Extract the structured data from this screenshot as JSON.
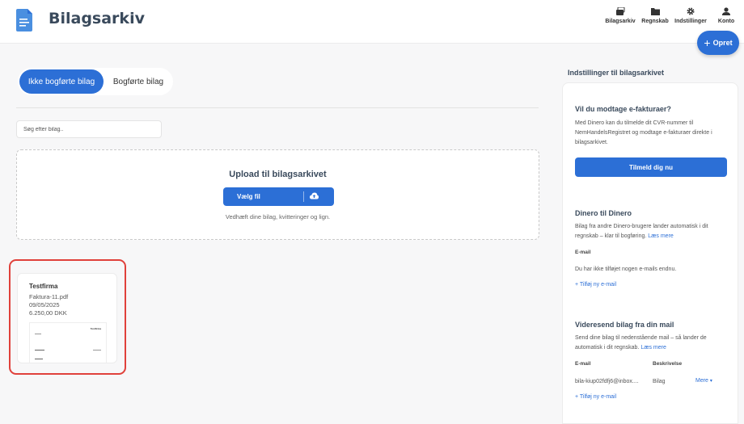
{
  "app": {
    "title": "Bilagsarkiv"
  },
  "nav": [
    {
      "label": "Bilagsarkiv",
      "icon": "archive-icon"
    },
    {
      "label": "Regnskab",
      "icon": "folder-icon"
    },
    {
      "label": "Indstillinger",
      "icon": "gear-icon"
    },
    {
      "label": "Konto",
      "icon": "user-icon"
    }
  ],
  "create_button": {
    "label": "Opret",
    "icon": "plus-icon"
  },
  "tabs": [
    {
      "label": "Ikke bogførte bilag",
      "active": true
    },
    {
      "label": "Bogførte bilag",
      "active": false
    }
  ],
  "search": {
    "placeholder": "Søg efter bilag..",
    "value": ""
  },
  "upload": {
    "title": "Upload til bilagsarkivet",
    "button_label": "Vælg fil",
    "hint": "Vedhæft dine bilag, kvitteringer og lign."
  },
  "documents": [
    {
      "company": "Testfirma",
      "filename": "Faktura-11.pdf",
      "date": "09/05/2025",
      "amount": "6.250,00 DKK",
      "preview_title": "Testfirma"
    }
  ],
  "sidebar": {
    "heading": "Indstillinger til bilagsarkivet",
    "einvoice": {
      "title": "Vil du modtage e-fakturaer?",
      "text": "Med Dinero kan du tilmelde dit CVR-nummer til NemHandelsRegistret og modtage e-fakturaer direkte i bilagsarkivet.",
      "button_label": "Tilmeld dig nu"
    },
    "dinero": {
      "title": "Dinero til Dinero",
      "text": "Bilag fra andre Dinero-brugere lander automatisk i dit regnskab – klar til bogføring.",
      "link": "Læs mere",
      "email_label": "E-mail",
      "empty_text": "Du har ikke tilføjet nogen e-mails endnu.",
      "add_link": "+ Tilføj ny e-mail"
    },
    "forward": {
      "title": "Videresend bilag fra din mail",
      "text": "Send dine bilag til nedenstående mail – så lander de automatisk i dit regnskab.",
      "link": "Læs mere",
      "col_email": "E-mail",
      "col_desc": "Beskrivelse",
      "row_email": "bila-kiup02fdfj6@inbox....",
      "row_desc": "Bilag",
      "more_label": "Mere",
      "add_link": "+ Tilføj ny e-mail"
    }
  },
  "colors": {
    "primary": "#2c6fd6",
    "highlight": "#e0413b",
    "heading": "#3a4a5c"
  }
}
